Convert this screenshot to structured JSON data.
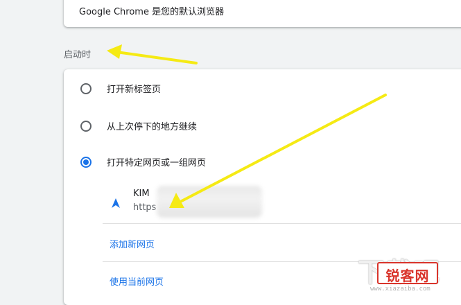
{
  "default_browser": {
    "text": "Google Chrome 是您的默认浏览器"
  },
  "startup": {
    "title": "启动时",
    "options": [
      {
        "label": "打开新标签页",
        "checked": false
      },
      {
        "label": "从上次停下的地方继续",
        "checked": false
      },
      {
        "label": "打开特定网页或一组网页",
        "checked": true
      }
    ],
    "page": {
      "title": "KIM",
      "url": "https"
    },
    "add_new_page": "添加新网页",
    "use_current_pages": "使用当前网页"
  },
  "watermark": {
    "brand": "下载吧",
    "label": "锐客网",
    "url": "www.xiazaiba.com"
  },
  "colors": {
    "accent": "#1a73e8",
    "annotation_arrow": "#f5ea14",
    "watermark_red": "#d9342b"
  },
  "icons": {
    "page": "navigation-arrow-icon"
  }
}
